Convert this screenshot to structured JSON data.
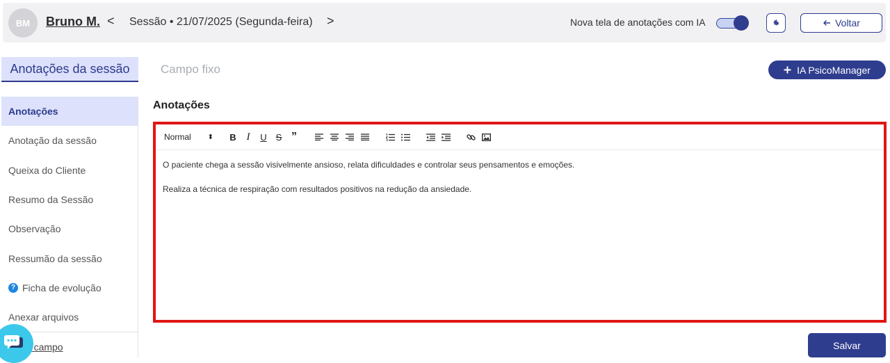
{
  "header": {
    "avatar_initials": "BM",
    "client_name": "Bruno M.",
    "prev_symbol": "<",
    "next_symbol": ">",
    "session_label": "Sessão • 21/07/2025 (Segunda-feira)",
    "ai_toggle_label": "Nova tela de anotações com IA",
    "ai_toggle_on": true,
    "back_label": "Voltar"
  },
  "tabs": {
    "session_notes": "Anotações da sessão",
    "fixed_field": "Campo fixo"
  },
  "ai_button_label": "IA PsicoManager",
  "sidebar": {
    "items": [
      {
        "label": "Anotações",
        "active": true
      },
      {
        "label": "Anotação da sessão"
      },
      {
        "label": "Queixa do Cliente"
      },
      {
        "label": "Resumo da Sessão"
      },
      {
        "label": "Observação"
      },
      {
        "label": "Ressumão da sessão"
      },
      {
        "label": "Ficha de evolução",
        "icon": "help-icon",
        "icon_glyph": "?"
      },
      {
        "label": "Anexar arquivos"
      }
    ],
    "new_field_label": "Novo campo"
  },
  "editor": {
    "title": "Anotações",
    "format_select": "Normal",
    "toolbar_icons": [
      "bold-icon",
      "italic-icon",
      "underline-icon",
      "strike-icon",
      "quote-icon",
      "align-left-icon",
      "align-center-icon",
      "align-right-icon",
      "align-justify-icon",
      "ordered-list-icon",
      "bullet-list-icon",
      "outdent-icon",
      "indent-icon",
      "link-icon",
      "image-icon"
    ],
    "paragraphs": [
      "O paciente chega a sessão visivelmente ansioso, relata dificuldades e controlar seus pensamentos e emoções.",
      "Realiza a técnica de respiração com resultados positivos na redução da ansiedade."
    ]
  },
  "save_label": "Salvar",
  "colors": {
    "primary": "#2f3d8f",
    "highlight_border": "#e01616",
    "active_bg": "#dde1fb",
    "chat_bubble": "#3cc8ea"
  }
}
